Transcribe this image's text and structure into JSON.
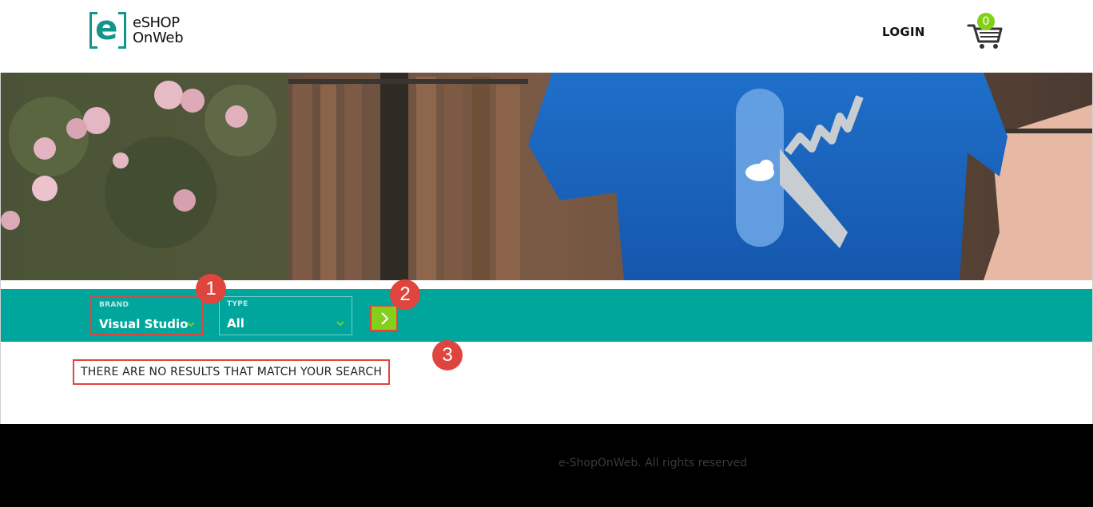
{
  "header": {
    "logo": {
      "line1": "eSHOP",
      "line2": "OnWeb",
      "mark_letter": "e"
    },
    "login_label": "LOGIN",
    "cart_count": "0"
  },
  "hero": {
    "image_icon": "hero-banner-image"
  },
  "filters": {
    "brand": {
      "label": "BRAND",
      "value": "Visual Studio"
    },
    "type": {
      "label": "TYPE",
      "value": "All"
    },
    "apply_icon": "chevron-right-icon"
  },
  "callouts": [
    "1",
    "2",
    "3"
  ],
  "results": {
    "message": "THERE ARE NO RESULTS THAT MATCH YOUR SEARCH"
  },
  "footer": {
    "text": "e-ShopOnWeb. All rights reserved"
  },
  "colors": {
    "teal": "#00a69c",
    "green_accent": "#83d01b",
    "callout_red": "#e0453d",
    "logo_teal": "#13958b"
  }
}
